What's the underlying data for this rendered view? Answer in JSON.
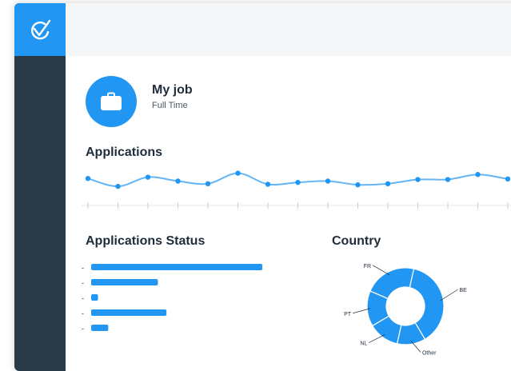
{
  "job": {
    "title": "My job",
    "subtitle": "Full Time"
  },
  "sections": {
    "applications": "Applications",
    "status": "Applications Status",
    "country": "Country"
  },
  "colors": {
    "accent": "#2196f3",
    "sidebar": "#2a3b47",
    "line": "#64b5f6"
  },
  "icons": {
    "logo": "check-logo-icon",
    "job": "briefcase-icon"
  },
  "chart_data": [
    {
      "type": "line",
      "x": [
        1,
        2,
        3,
        4,
        5,
        6,
        7,
        8,
        9,
        10,
        11,
        12,
        13,
        14,
        15
      ],
      "values": [
        6,
        3,
        6.5,
        5,
        4,
        8,
        3.8,
        4.5,
        5,
        3.6,
        4,
        5.6,
        5.6,
        7.5,
        5.8
      ],
      "ylim": [
        0,
        10
      ]
    },
    {
      "type": "bar",
      "orientation": "horizontal",
      "categories": [
        "-",
        "-",
        "-",
        "-",
        "-"
      ],
      "values": [
        100,
        39,
        4,
        44,
        10
      ],
      "xlim": [
        0,
        100
      ]
    },
    {
      "type": "pie",
      "donut": true,
      "labels": [
        "BE",
        "Other",
        "NL",
        "PT",
        "FR"
      ],
      "values": [
        38,
        12,
        13,
        15,
        22
      ]
    }
  ]
}
